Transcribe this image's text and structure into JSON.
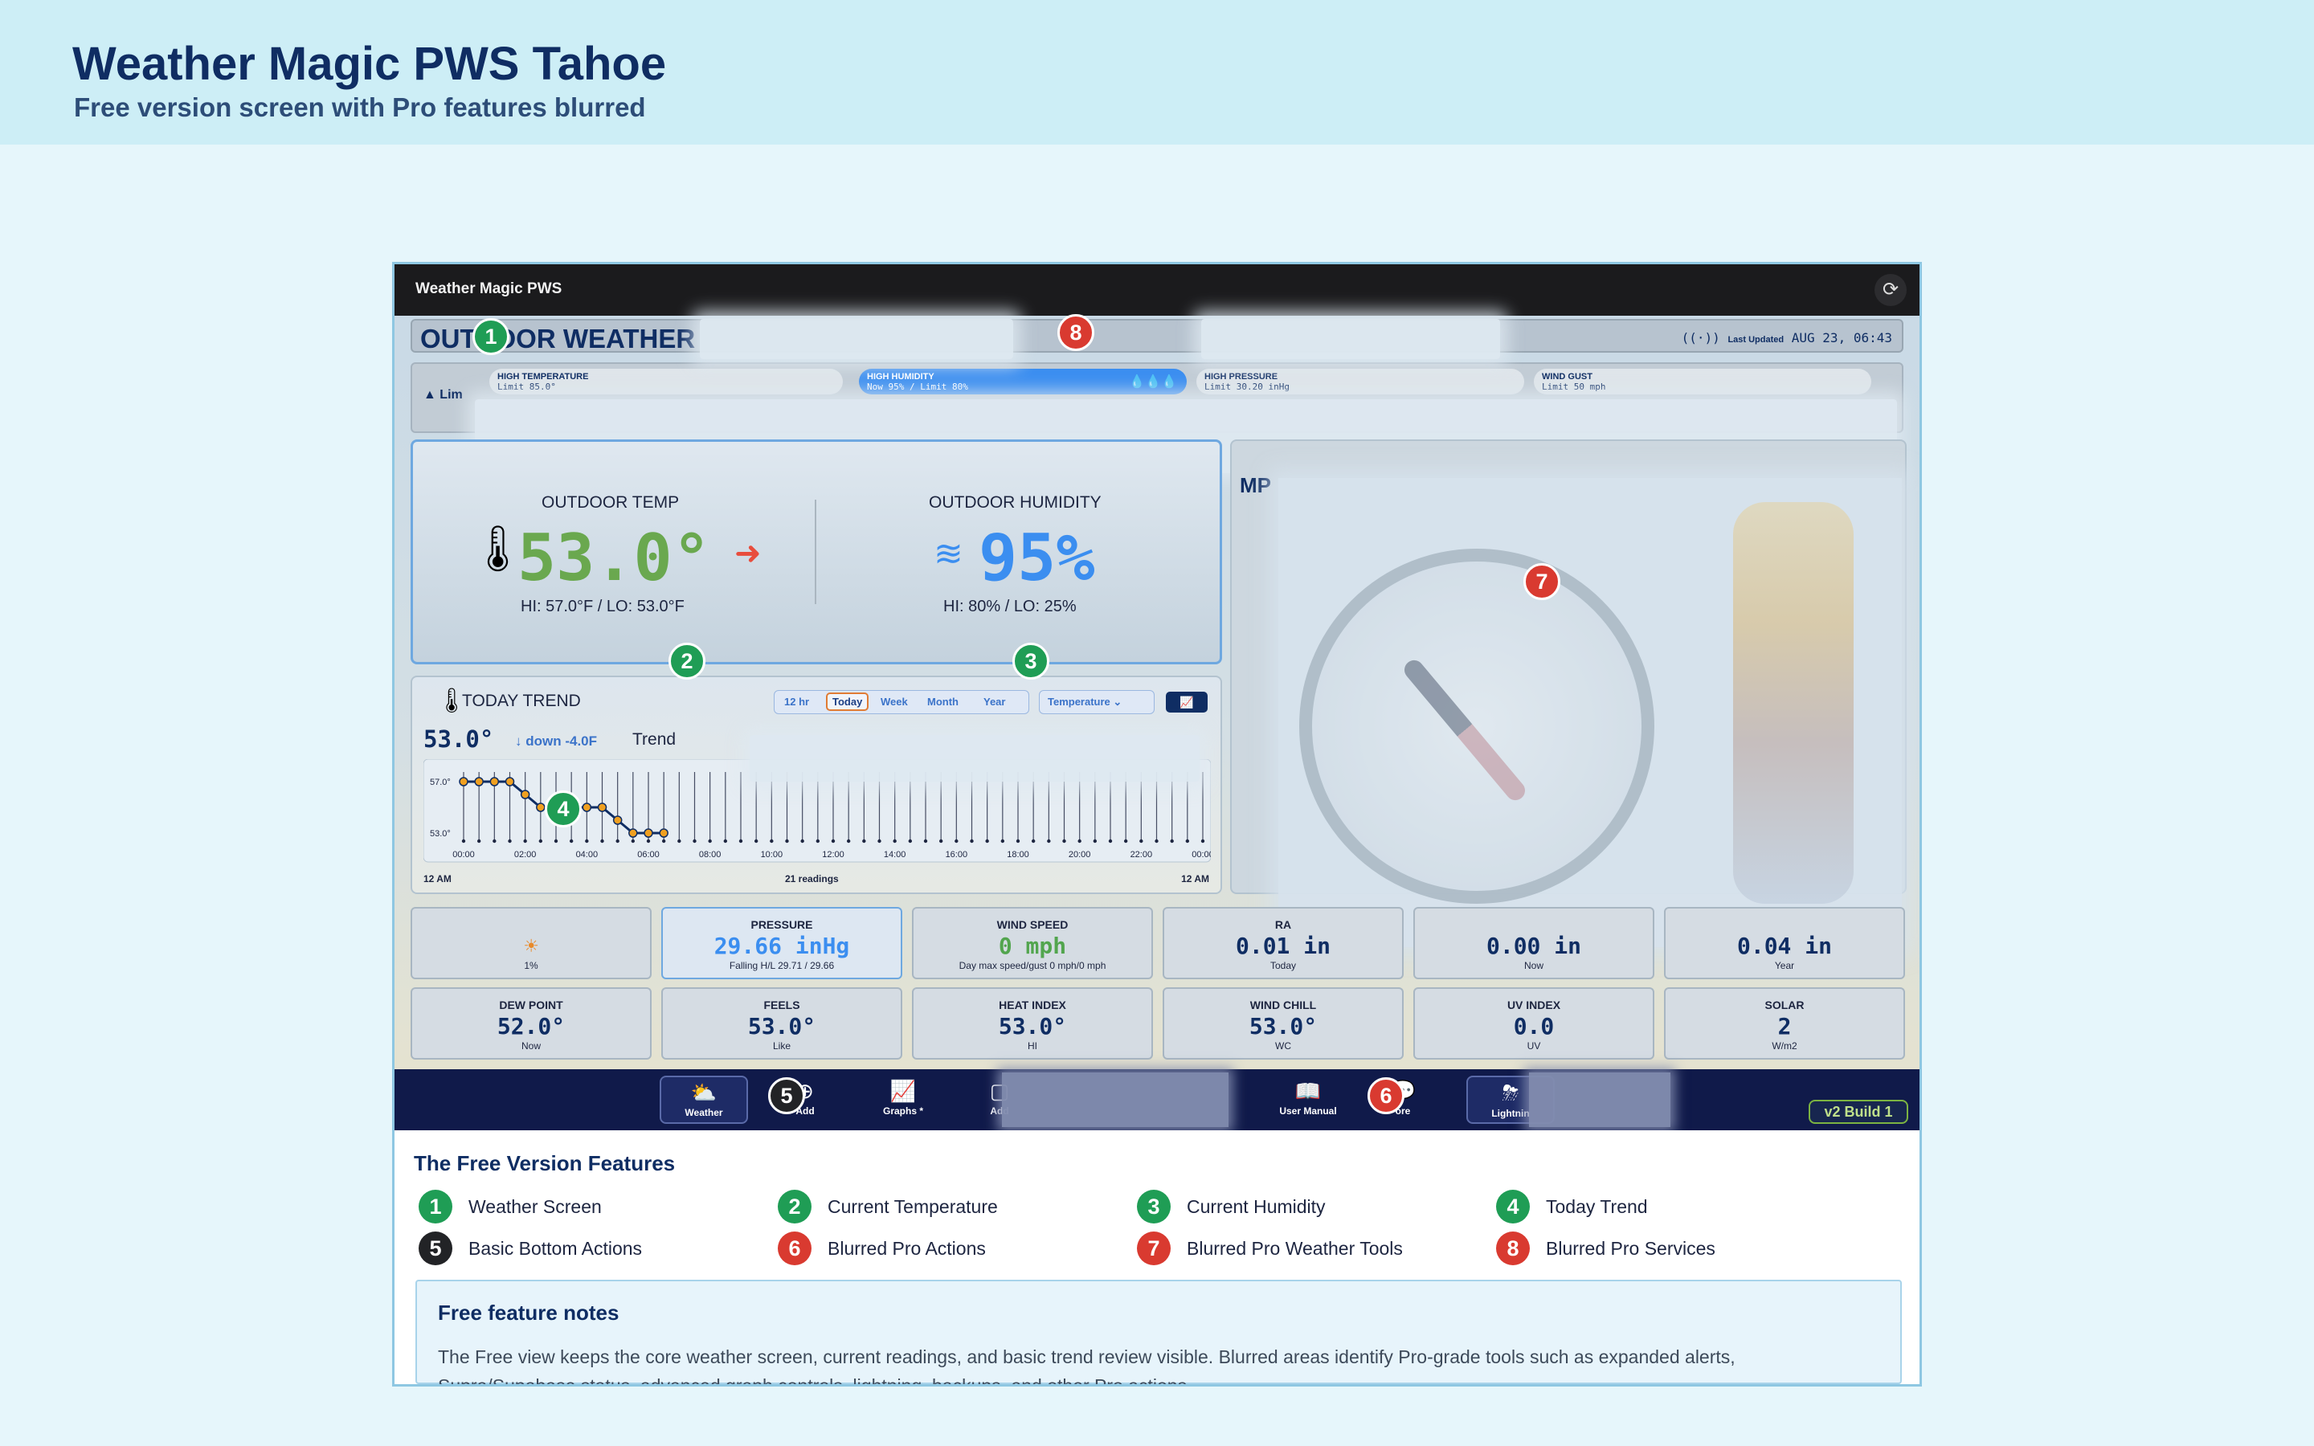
{
  "header": {
    "title": "Weather Magic PWS Tahoe",
    "subtitle": "Free version screen with Pro features blurred"
  },
  "app": {
    "name": "Weather Magic PWS",
    "refresh_icon": "refresh-icon",
    "outdoor_title": "OUTDOOR WEATHER",
    "last_updated_label": "Last Updated",
    "last_updated_value": "AUG 23, 06:43",
    "alerts": {
      "warn_label": "Lim",
      "chips": [
        {
          "name": "HIGH TEMPERATURE",
          "value": "Limit 85.0°"
        },
        {
          "name": "HIGH HUMIDITY",
          "value": "Now 95% / Limit 80%"
        },
        {
          "name": "HIGH PRESSURE",
          "value": "Limit 30.20 inHg"
        },
        {
          "name": "WIND GUST",
          "value": "Limit 50 mph"
        }
      ]
    },
    "readings": {
      "temp_label": "OUTDOOR TEMP",
      "temp_value": "53.0°",
      "temp_hilo": "HI: 57.0°F / LO: 53.0°F",
      "humidity_label": "OUTDOOR HUMIDITY",
      "humidity_value": "95%",
      "humidity_hilo": "HI: 80% / LO: 25%",
      "colors": {
        "temp": "#6aa84f",
        "humidity": "#3b8ef0",
        "trend_arrow": "#e84d3d"
      }
    },
    "trend": {
      "title": "TODAY TREND",
      "ranges": [
        "12 hr",
        "Today",
        "Week",
        "Month",
        "Year"
      ],
      "selected_range": "Today",
      "metric": "Temperature",
      "current": "53.0°",
      "delta": "↓ down -4.0F",
      "trend_word": "Trend",
      "footer_left": "12 AM",
      "footer_center": "21 readings",
      "footer_right": "12 AM"
    },
    "tools_label": "MP",
    "tiles_row1": [
      {
        "title": "",
        "value": "☀",
        "sub": "1%"
      },
      {
        "title": "PRESSURE",
        "value": "29.66 inHg",
        "sub": "Falling H/L 29.71 / 29.66"
      },
      {
        "title": "WIND SPEED",
        "value": "0 mph",
        "sub": "Day max speed/gust 0 mph/0 mph"
      },
      {
        "title": "RA",
        "value": "0.01 in",
        "sub": "Today"
      },
      {
        "title": "",
        "value": "0.00 in",
        "sub": "Now"
      },
      {
        "title": "",
        "value": "0.04 in",
        "sub": "Year"
      }
    ],
    "tiles_row2": [
      {
        "title": "DEW POINT",
        "value": "52.0°",
        "sub": "Now"
      },
      {
        "title": "FEELS",
        "value": "53.0°",
        "sub": "Like"
      },
      {
        "title": "HEAT INDEX",
        "value": "53.0°",
        "sub": "HI"
      },
      {
        "title": "WIND CHILL",
        "value": "53.0°",
        "sub": "WC"
      },
      {
        "title": "UV INDEX",
        "value": "0.0",
        "sub": "UV"
      },
      {
        "title": "SOLAR",
        "value": "2",
        "sub": "W/m2"
      }
    ],
    "nav": {
      "weather": "Weather",
      "add": "Add",
      "graphs": "Graphs *",
      "add_b": "Add",
      "manual": "User Manual",
      "more": "ore",
      "lightning": "Lightnin",
      "version": "v2 Build 1"
    }
  },
  "chart_data": {
    "type": "line",
    "x": [
      "00:00",
      "00:30",
      "01:00",
      "01:30",
      "02:00",
      "02:30",
      "03:00",
      "03:30",
      "04:00",
      "04:30",
      "05:00",
      "05:30",
      "06:00",
      "06:30"
    ],
    "series": [
      {
        "values": [
          57,
          57,
          57,
          57,
          56,
          55,
          55,
          55,
          55,
          55,
          54,
          53,
          53,
          53
        ]
      }
    ],
    "xticks": [
      "00:00",
      "02:00",
      "04:00",
      "06:00",
      "08:00",
      "10:00",
      "12:00",
      "14:00",
      "16:00",
      "18:00",
      "20:00",
      "22:00",
      "00:00"
    ],
    "yticks": [
      "57.0°",
      "53.0°"
    ],
    "ylim": [
      53,
      57
    ]
  },
  "legend": {
    "title": "The Free Version Features",
    "items": [
      {
        "num": "1",
        "label": "Weather Screen",
        "color": "#1f9d55"
      },
      {
        "num": "2",
        "label": "Current Temperature",
        "color": "#1f9d55"
      },
      {
        "num": "3",
        "label": "Current Humidity",
        "color": "#1f9d55"
      },
      {
        "num": "4",
        "label": "Today Trend",
        "color": "#1f9d55"
      },
      {
        "num": "5",
        "label": "Basic Bottom Actions",
        "color": "#222326"
      },
      {
        "num": "6",
        "label": "Blurred Pro Actions",
        "color": "#d93a30"
      },
      {
        "num": "7",
        "label": "Blurred Pro Weather Tools",
        "color": "#d93a30"
      },
      {
        "num": "8",
        "label": "Blurred Pro Services",
        "color": "#d93a30"
      }
    ],
    "notes_title": "Free feature notes",
    "notes_body": "The Free view keeps the core weather screen, current readings, and basic trend review visible. Blurred areas identify Pro-grade tools such as expanded alerts, Supra/Supabase status, advanced graph controls, lightning, backups, and other Pro actions."
  },
  "badges": [
    "1",
    "2",
    "3",
    "4",
    "5",
    "6",
    "7",
    "8"
  ]
}
